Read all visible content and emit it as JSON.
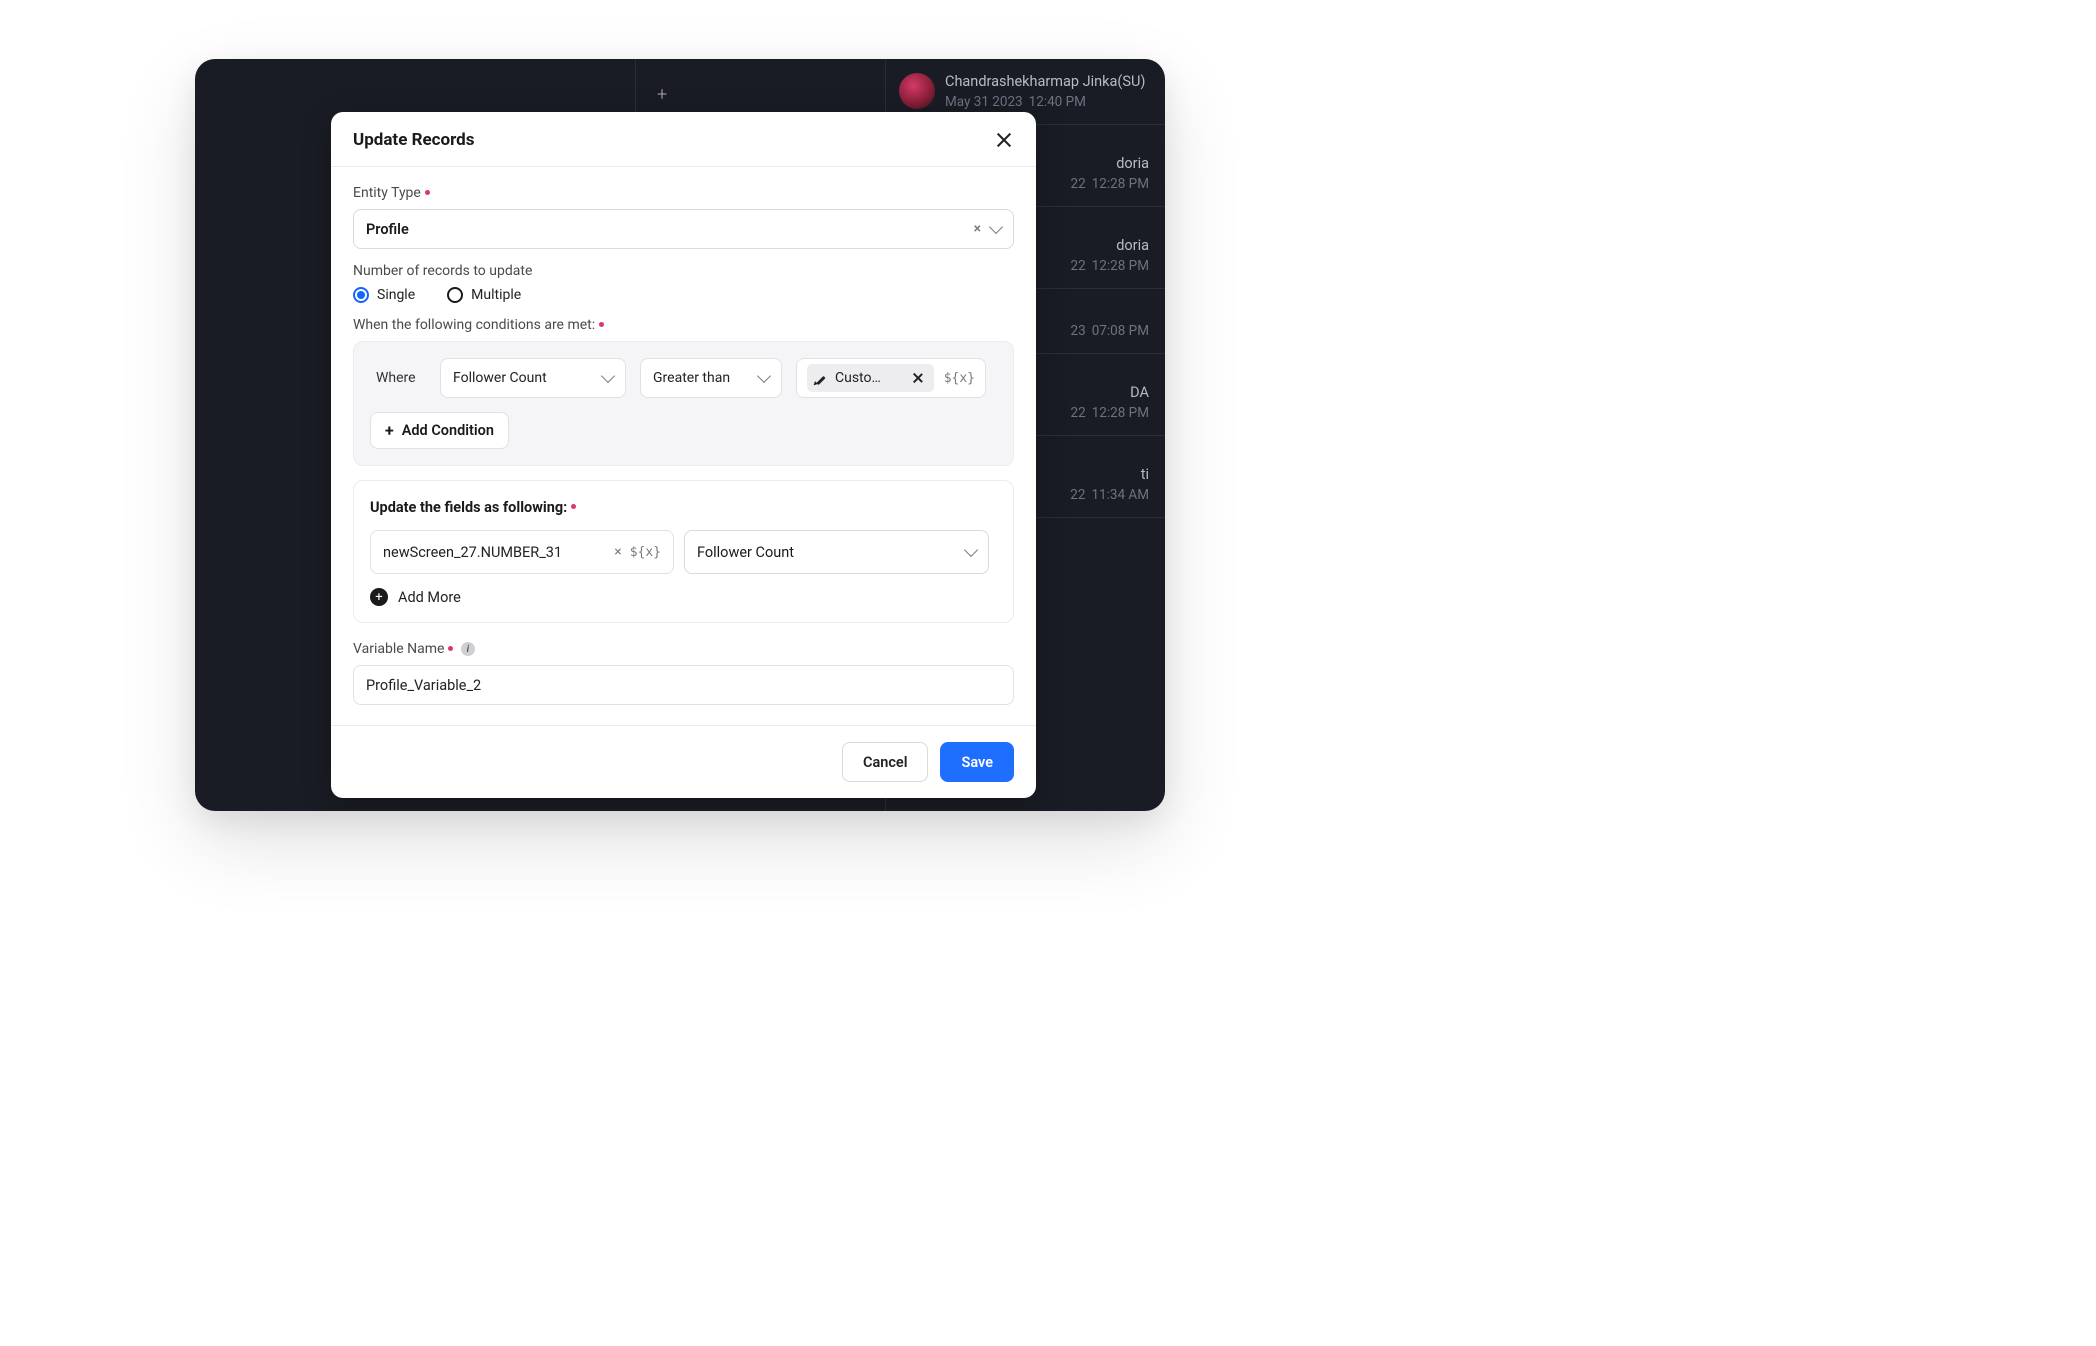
{
  "background": {
    "plus": "+",
    "items": [
      {
        "name": "Chandrashekharmap Jinka(SU)",
        "date": "May 31 2023",
        "time": "12:40 PM",
        "avatar": true
      },
      {
        "name": "doria",
        "date": "22",
        "time": "12:28 PM"
      },
      {
        "name": "doria",
        "date": "22",
        "time": "12:28 PM"
      },
      {
        "name": "",
        "date": "23",
        "time": "07:08 PM"
      },
      {
        "name": "DA",
        "date": "22",
        "time": "12:28 PM"
      },
      {
        "name": "ti",
        "date": "22",
        "time": "11:34 AM"
      }
    ]
  },
  "modal": {
    "title": "Update Records",
    "entity_type_label": "Entity Type",
    "entity_type_value": "Profile",
    "num_records_label": "Number of records to update",
    "radio_single": "Single",
    "radio_multiple": "Multiple",
    "radio_selected": "single",
    "conditions_label": "When the following conditions are met:",
    "where_label": "Where",
    "cond_field": "Follower Count",
    "cond_operator": "Greater than",
    "cond_value_chip": "Custo…",
    "var_glyph": "${x}",
    "add_condition": "Add Condition",
    "update_fields_label": "Update the fields as following:",
    "update_value": "newScreen_27.NUMBER_31",
    "update_field": "Follower Count",
    "add_more": "Add More",
    "variable_name_label": "Variable Name",
    "variable_name_value": "Profile_Variable_2",
    "cancel": "Cancel",
    "save": "Save"
  }
}
